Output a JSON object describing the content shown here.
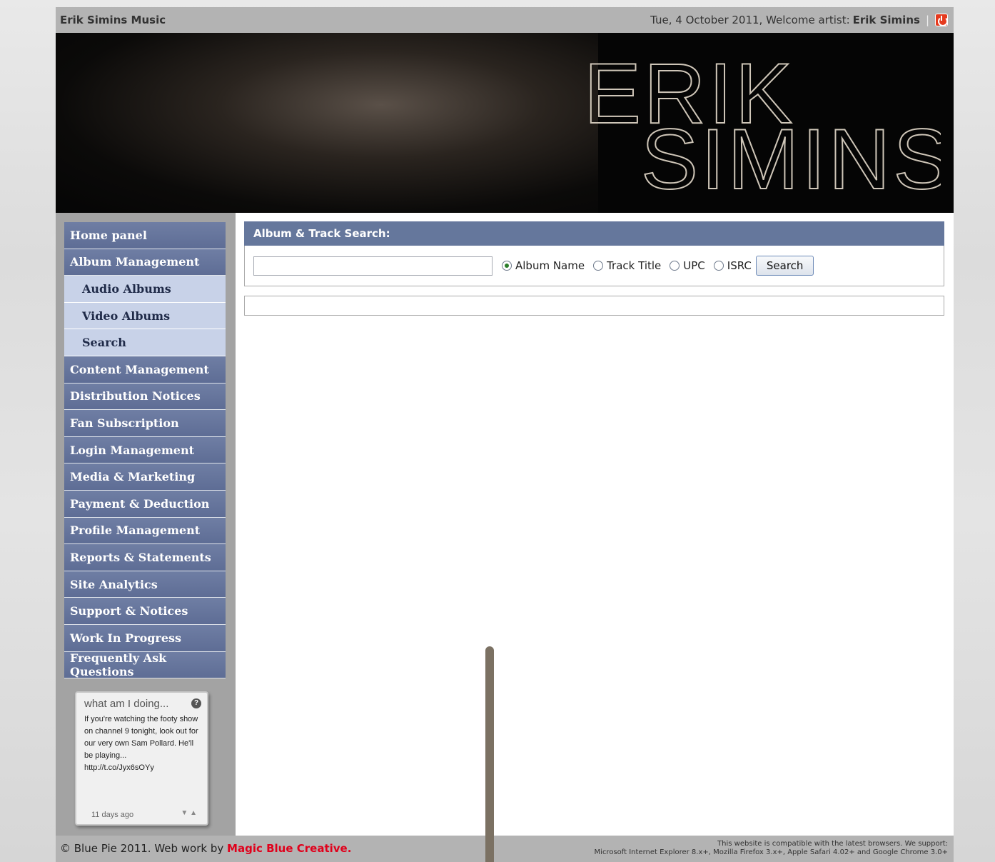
{
  "topbar": {
    "brand": "Erik Simins Music",
    "date_welcome": "Tue, 4 October 2011, Welcome artist:",
    "artist": "Erik Simins"
  },
  "banner": {
    "logo_line1": "ERIK",
    "logo_line2": "SIMINS"
  },
  "sidebar": {
    "items": [
      {
        "label": "Home panel",
        "type": "main"
      },
      {
        "label": "Album Management",
        "type": "main"
      },
      {
        "label": "Audio Albums",
        "type": "sub"
      },
      {
        "label": "Video Albums",
        "type": "sub"
      },
      {
        "label": "Search",
        "type": "sub"
      },
      {
        "label": "Content Management",
        "type": "main"
      },
      {
        "label": "Distribution Notices",
        "type": "main"
      },
      {
        "label": "Fan Subscription",
        "type": "main"
      },
      {
        "label": "Login Management",
        "type": "main"
      },
      {
        "label": "Media & Marketing",
        "type": "main"
      },
      {
        "label": "Payment & Deduction",
        "type": "main"
      },
      {
        "label": "Profile Management",
        "type": "main"
      },
      {
        "label": "Reports & Statements",
        "type": "main"
      },
      {
        "label": "Site Analytics",
        "type": "main"
      },
      {
        "label": "Support & Notices",
        "type": "main"
      },
      {
        "label": "Work In Progress",
        "type": "main"
      },
      {
        "label": "Frequently Ask Questions",
        "type": "main"
      }
    ]
  },
  "widget": {
    "title": "what am I doing...",
    "text": "If you're watching the footy show on channel 9 tonight, look out for our very own Sam Pollard. He'll be playing... http://t.co/Jyx6sOYy",
    "time": "11 days ago"
  },
  "search_panel": {
    "title": "Album & Track Search:",
    "input_value": "",
    "options": [
      {
        "label": "Album Name",
        "checked": true
      },
      {
        "label": "Track Title",
        "checked": false
      },
      {
        "label": "UPC",
        "checked": false
      },
      {
        "label": "ISRC",
        "checked": false
      }
    ],
    "button_label": "Search"
  },
  "footer": {
    "copyright": "© Blue Pie 2011. Web work by",
    "credit": "Magic Blue Creative.",
    "compat_line1": "This website is compatible with the latest browsers. We support:",
    "compat_line2": "Microsoft Internet Explorer 8.x+, Mozilla Firefox 3.x+, Apple Safari 4.02+ and Google Chrome 3.0+"
  },
  "colors": {
    "nav_bg": "#65779c",
    "nav_sub_bg": "#c8d2e8",
    "credit_red": "#e0001b"
  }
}
